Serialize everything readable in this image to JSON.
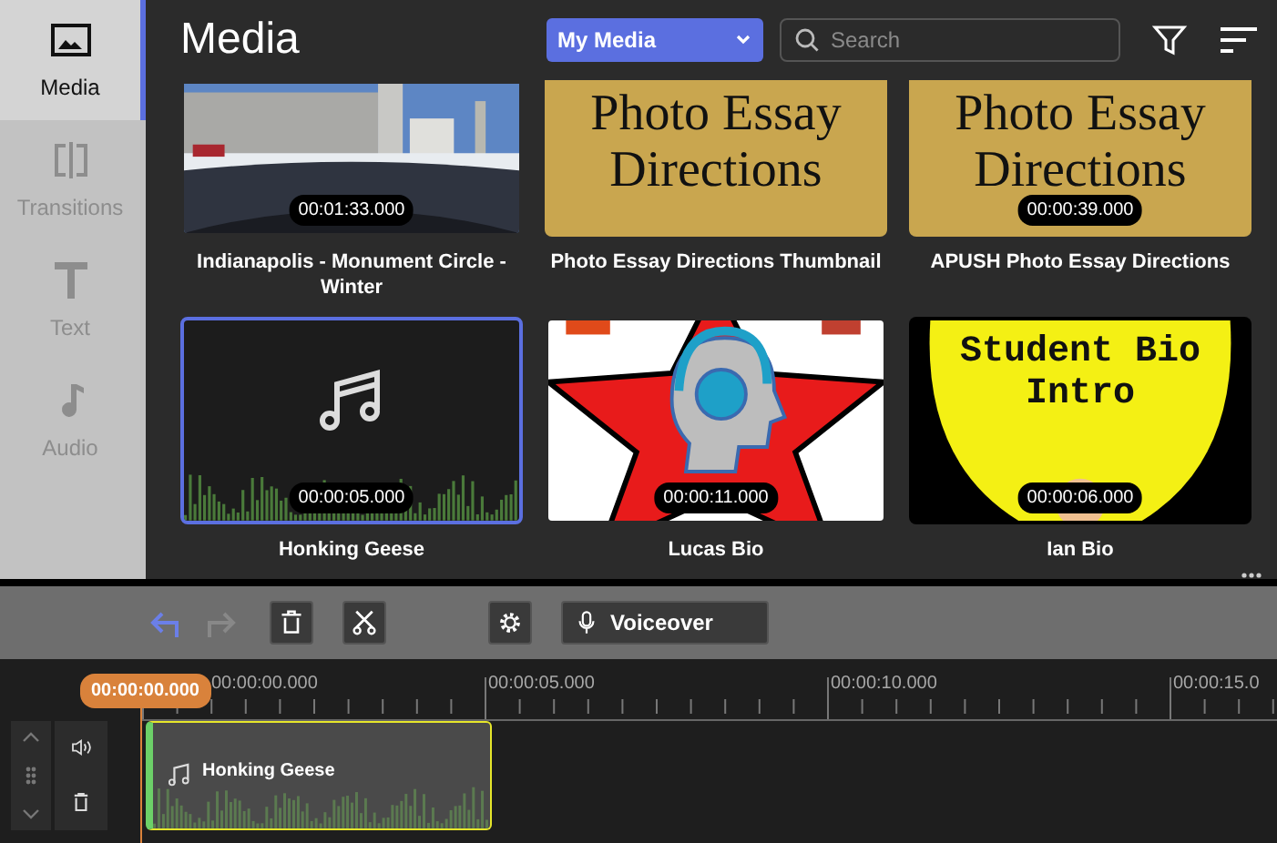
{
  "sidebar": {
    "items": [
      {
        "kind": "media",
        "label": "Media",
        "selected": true
      },
      {
        "kind": "transitions",
        "label": "Transitions",
        "selected": false
      },
      {
        "kind": "text",
        "label": "Text",
        "selected": false
      },
      {
        "kind": "audio",
        "label": "Audio",
        "selected": false
      }
    ]
  },
  "header": {
    "title": "Media",
    "source": "My Media",
    "search": {
      "placeholder": "Search"
    }
  },
  "media": [
    {
      "title": "Indianapolis - Monument Circle - Winter",
      "duration": "00:01:33.000",
      "selected": false
    },
    {
      "title": "Photo Essay Directions Thumbnail",
      "selected": false,
      "thumbnail": {
        "kind": "slide",
        "text": "Photo Essay Directions"
      }
    },
    {
      "title": "APUSH Photo Essay Directions",
      "duration": "00:00:39.000",
      "selected": false,
      "thumbnail": {
        "kind": "slide",
        "text": "Photo Essay Directions"
      }
    },
    {
      "title": "Honking Geese",
      "duration": "00:00:05.000",
      "selected": true,
      "thumbnail": {
        "kind": "audio"
      }
    },
    {
      "title": "Lucas Bio",
      "duration": "00:00:11.000",
      "selected": false
    },
    {
      "title": "Ian Bio",
      "duration": "00:00:06.000",
      "selected": false,
      "thumbnail": {
        "kind": "poster",
        "text": "Student Bio Intro"
      }
    }
  ],
  "toolbar": {
    "undo": {
      "disabled": false
    },
    "redo": {
      "disabled": true
    },
    "voiceover": "Voiceover"
  },
  "timeline": {
    "playhead": "00:00:00.000",
    "ruler": [
      "00:00:00.000",
      "00:00:05.000",
      "00:00:10.000",
      "00:00:15.0"
    ],
    "clips": [
      {
        "title": "Honking Geese"
      }
    ]
  }
}
